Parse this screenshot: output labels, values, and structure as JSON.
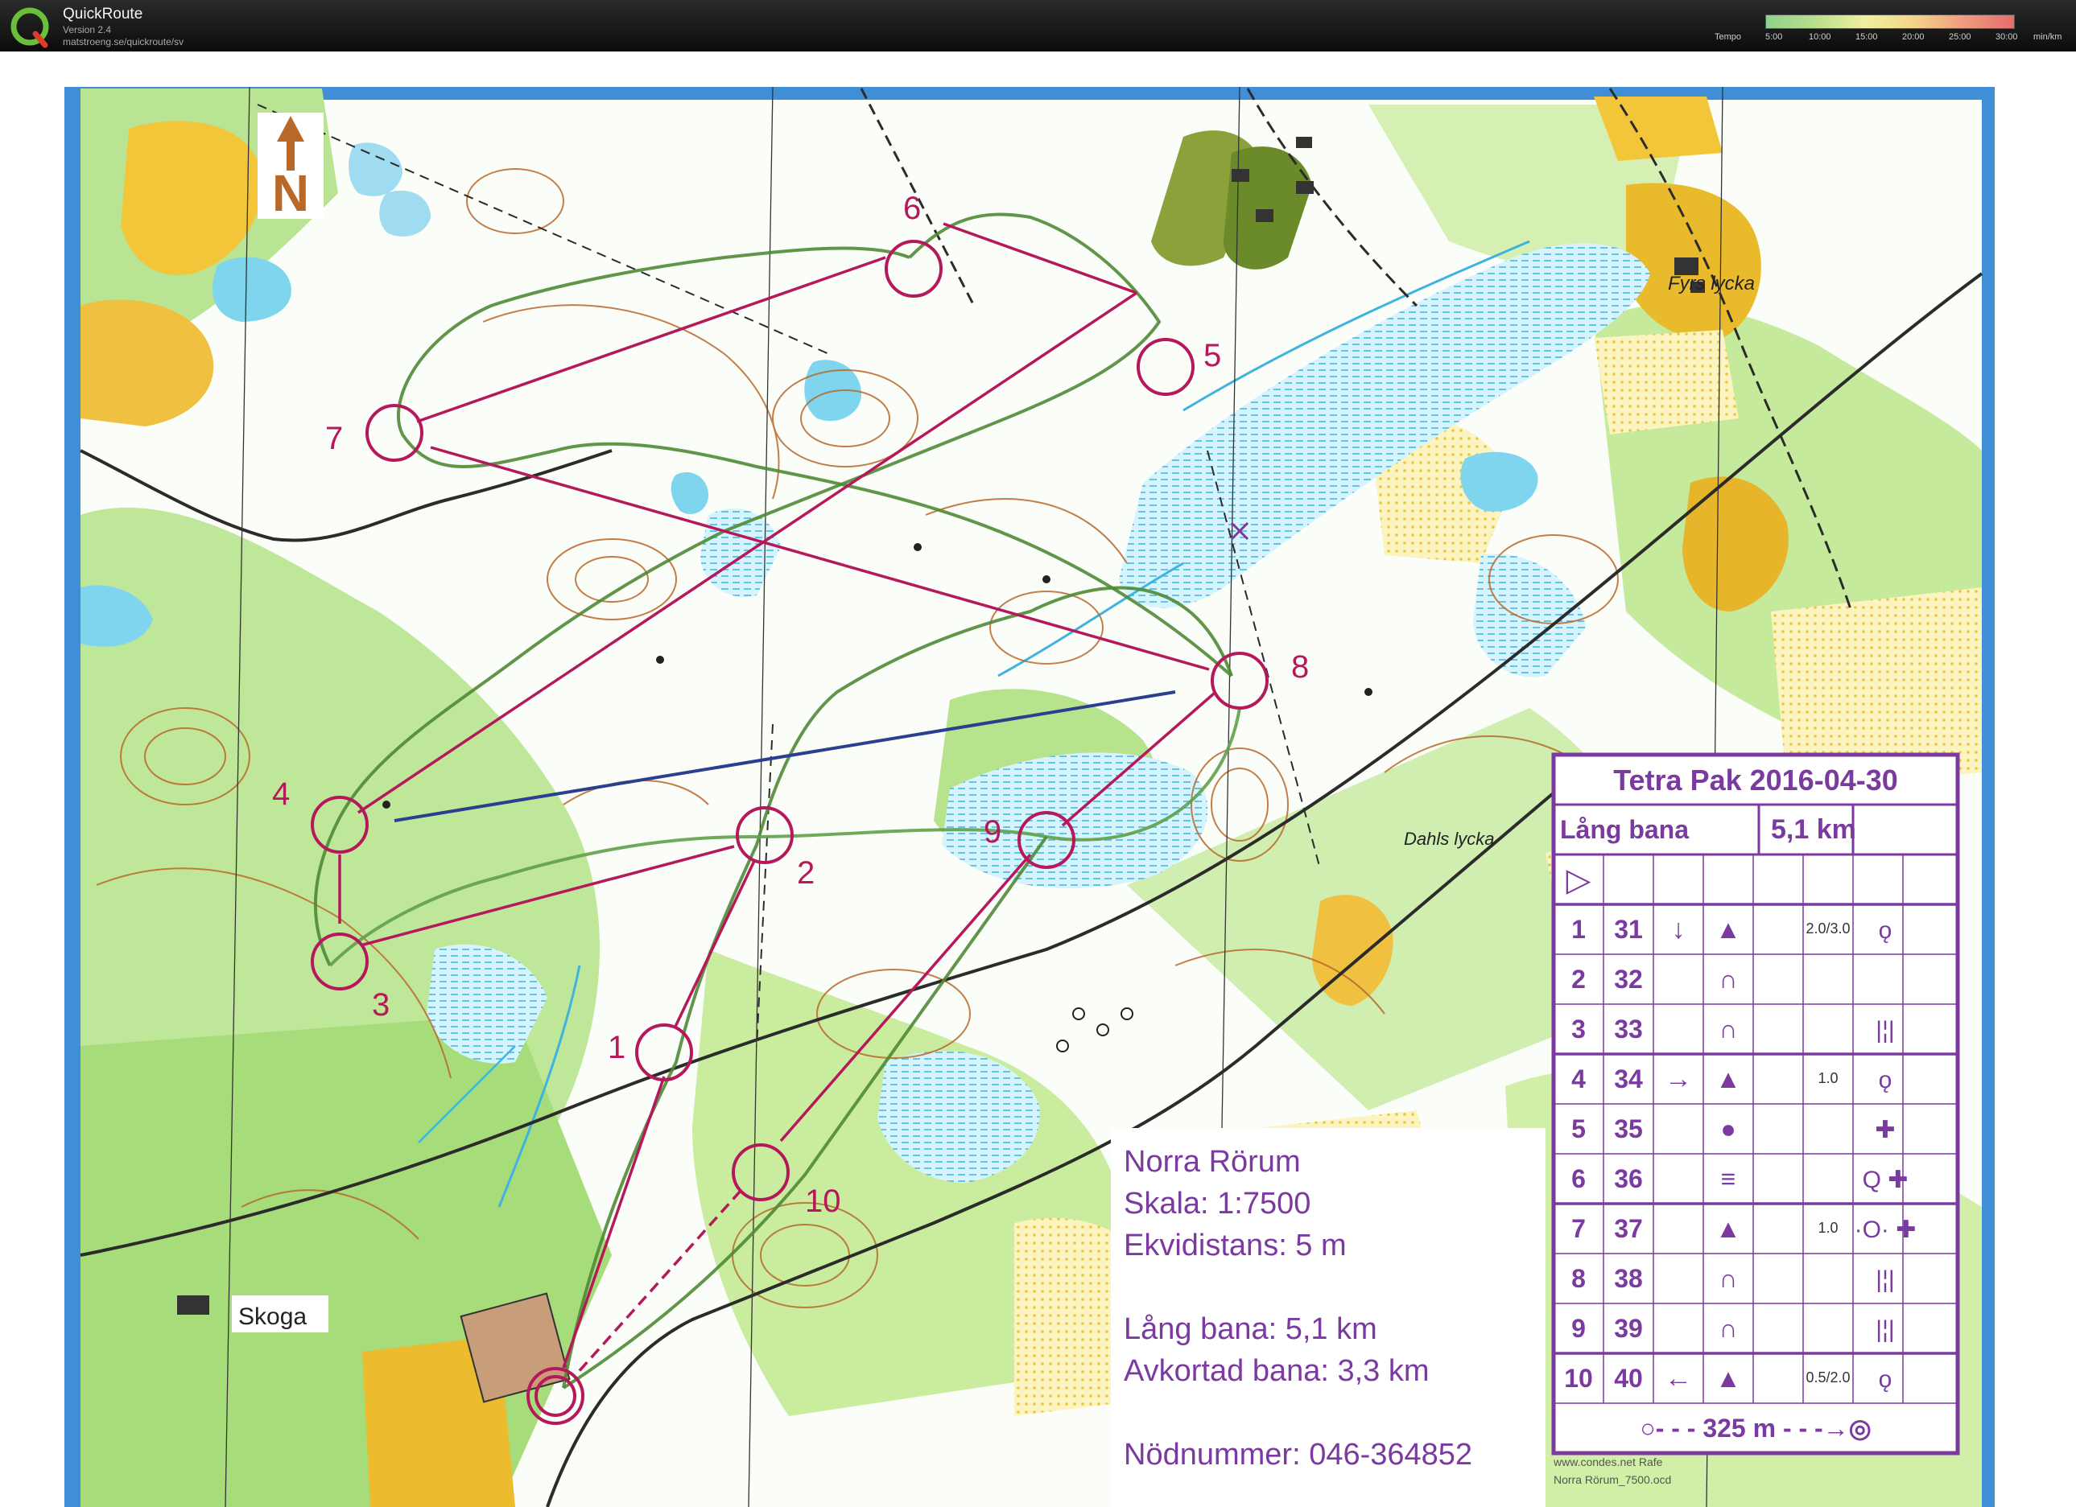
{
  "app": {
    "title": "QuickRoute",
    "version": "Version 2.4",
    "url": "matstroeng.se/quickroute/sv"
  },
  "tempo_legend": {
    "label": "Tempo",
    "ticks": [
      "5:00",
      "10:00",
      "15:00",
      "20:00",
      "25:00",
      "30:00"
    ],
    "unit": "min/km"
  },
  "map": {
    "north_symbol": "N",
    "place_names": [
      "Fyrs lycka",
      "Dahls lycka",
      "Skoga"
    ],
    "control_numbers": [
      "1",
      "2",
      "3",
      "4",
      "5",
      "6",
      "7",
      "8",
      "9",
      "10"
    ],
    "info_box": {
      "area": "Norra Rörum",
      "scale": "Skala: 1:7500",
      "contour": "Ekvidistans: 5 m",
      "long_course": "Lång bana: 5,1 km",
      "short_course": "Avkortad bana: 3,3 km",
      "emergency": "Nödnummer: 046-364852"
    },
    "credit_line1": "www.condes.net Rafe",
    "credit_line2": "Norra Rörum_7500.ocd",
    "description_sheet": {
      "title": "Tetra Pak 2016-04-30",
      "course": "Lång bana",
      "length": "5,1 km",
      "start_symbol": "▷",
      "rows": [
        {
          "n": "1",
          "code": "31",
          "dir": "↓",
          "feat": "▲",
          "dim": "2.0/3.0",
          "loc": "ǫ"
        },
        {
          "n": "2",
          "code": "32",
          "dir": "",
          "feat": "∩",
          "dim": "",
          "loc": ""
        },
        {
          "n": "3",
          "code": "33",
          "dir": "",
          "feat": "∩",
          "dim": "",
          "loc": "|¦|"
        },
        {
          "n": "4",
          "code": "34",
          "dir": "→",
          "feat": "▲",
          "dim": "1.0",
          "loc": "ǫ"
        },
        {
          "n": "5",
          "code": "35",
          "dir": "",
          "feat": "●",
          "dim": "",
          "loc": "✚"
        },
        {
          "n": "6",
          "code": "36",
          "dir": "",
          "feat": "≡",
          "dim": "",
          "loc": "Q ✚"
        },
        {
          "n": "7",
          "code": "37",
          "dir": "",
          "feat": "▲",
          "dim": "1.0",
          "loc": "·O· ✚"
        },
        {
          "n": "8",
          "code": "38",
          "dir": "",
          "feat": "∩",
          "dim": "",
          "loc": "|¦|"
        },
        {
          "n": "9",
          "code": "39",
          "dir": "",
          "feat": "∩",
          "dim": "",
          "loc": "|¦|"
        },
        {
          "n": "10",
          "code": "40",
          "dir": "←",
          "feat": "▲",
          "dim": "0.5/2.0",
          "loc": "ǫ"
        }
      ],
      "finish": "325 m"
    }
  },
  "colors": {
    "course": "#b5195b",
    "route_green": "#4f8a36",
    "route_blue": "#2a3f8f",
    "sheet": "#7a3aa0",
    "contour": "#b8692a",
    "forest": "#bfe79a",
    "open": "#f3c63a",
    "water": "#7fd4ee"
  }
}
